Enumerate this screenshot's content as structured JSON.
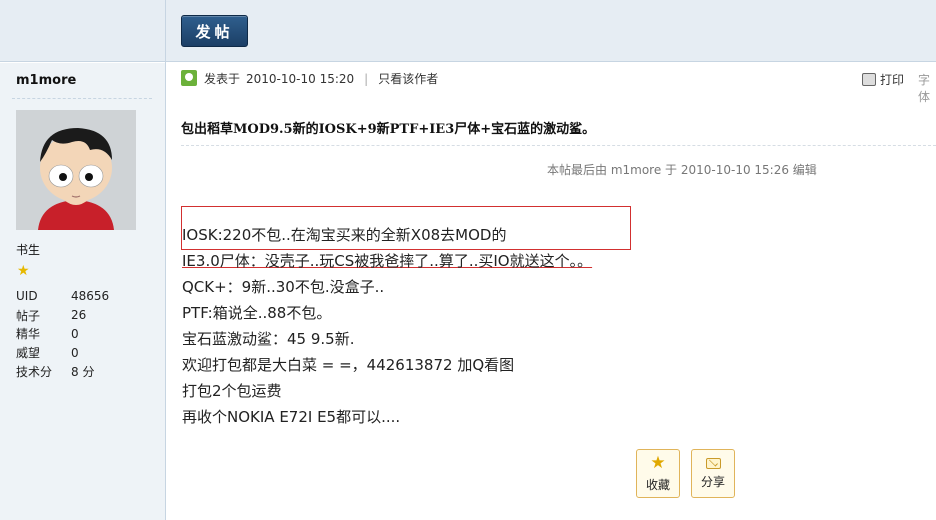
{
  "toolbar": {
    "post_label": "发帖"
  },
  "author": {
    "username": "m1more",
    "rank": "书生",
    "stats": [
      {
        "label": "UID",
        "value": "48656"
      },
      {
        "label": "帖子",
        "value": "26"
      },
      {
        "label": "精华",
        "value": "0"
      },
      {
        "label": "威望",
        "value": "0"
      },
      {
        "label": "技术分",
        "value": "8 分"
      }
    ]
  },
  "post": {
    "posted_label": "发表于",
    "posted_time": "2010-10-10 15:20",
    "only_author": "只看该作者",
    "print_label": "打印",
    "font_label": "字体",
    "title": "包出稻草MOD9.5新的IOSK+9新PTF+IE3尸体+宝石蓝的激动鲨。",
    "edit_note": "本帖最后由 m1more 于 2010-10-10 15:26 编辑",
    "lines": [
      "IOSK:220不包..在淘宝买来的全新X08去MOD的",
      "IE3.0尸体：没壳子..玩CS被我爸摔了..算了..买IO就送这个。。",
      "QCK+：9新..30不包.没盒子..",
      "PTF:箱说全..88不包。",
      "宝石蓝激动鲨：45 9.5新.",
      "欢迎打包都是大白菜  = =，442613872 加Q看图",
      "打包2个包运费",
      "再收个NOKIA E72I E5都可以...."
    ]
  },
  "actions": {
    "favorite": "收藏",
    "share": "分享"
  },
  "colors": {
    "accent": "#1c3f66",
    "highlight_border": "#d23030",
    "sidebar_bg": "#eef3f7"
  },
  "icons": [
    "post-author-icon",
    "print-icon",
    "star-icon",
    "favorite-star-icon",
    "share-envelope-icon"
  ]
}
